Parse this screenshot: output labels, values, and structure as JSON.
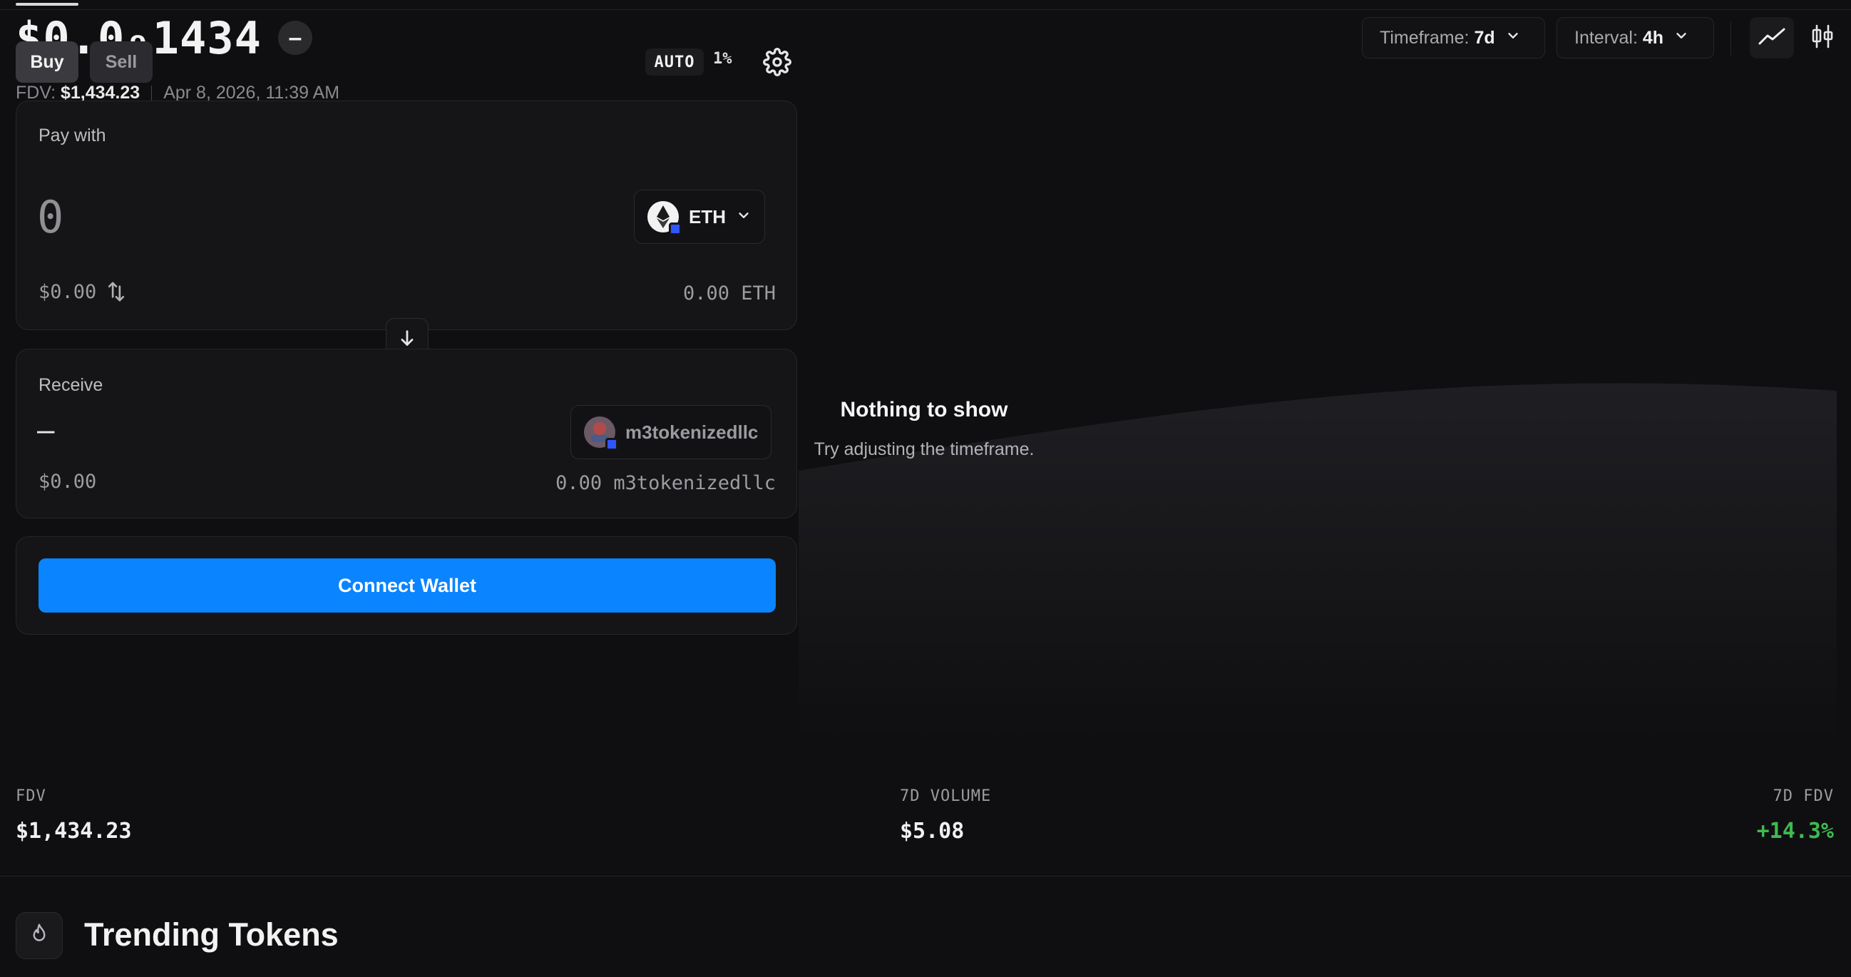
{
  "header": {
    "price": "$0.0₉1434",
    "change_badge": "–",
    "fdv_label": "FDV:",
    "fdv_value": "$1,434.23",
    "timestamp": "Apr 8, 2026, 11:39 AM"
  },
  "trade_tabs": {
    "buy": "Buy",
    "sell": "Sell"
  },
  "slippage": {
    "mode": "AUTO",
    "value": "1%"
  },
  "pay": {
    "label": "Pay with",
    "amount": "0",
    "token": "ETH",
    "usd_value": "$0.00",
    "balance": "0.00 ETH"
  },
  "receive": {
    "label": "Receive",
    "amount": "–",
    "token": "m3tokenizedllc",
    "usd_value": "$0.00",
    "balance": "0.00 m3tokenizedllc"
  },
  "connect_label": "Connect Wallet",
  "chart_controls": {
    "timeframe_label": "Timeframe:",
    "timeframe_value": "7d",
    "interval_label": "Interval:",
    "interval_value": "4h"
  },
  "empty_state": {
    "title": "Nothing to show",
    "subtitle": "Try adjusting the timeframe."
  },
  "stats": {
    "fdv_label": "FDV",
    "fdv_value": "$1,434.23",
    "volume_label": "7D VOLUME",
    "volume_value": "$5.08",
    "fdv_change_label": "7D FDV",
    "fdv_change_value": "+14.3%"
  },
  "trending_title": "Trending Tokens",
  "colors": {
    "accent": "#0a84ff",
    "positive": "#3fb950",
    "background": "#0f0f11",
    "panel": "#151517"
  },
  "icons": [
    "gear-icon",
    "eth-token-icon",
    "chevron-down-icon",
    "swap-vertical-icon",
    "arrow-down-icon",
    "token-avatar-icon",
    "line-chart-icon",
    "candlestick-icon",
    "flame-icon"
  ]
}
